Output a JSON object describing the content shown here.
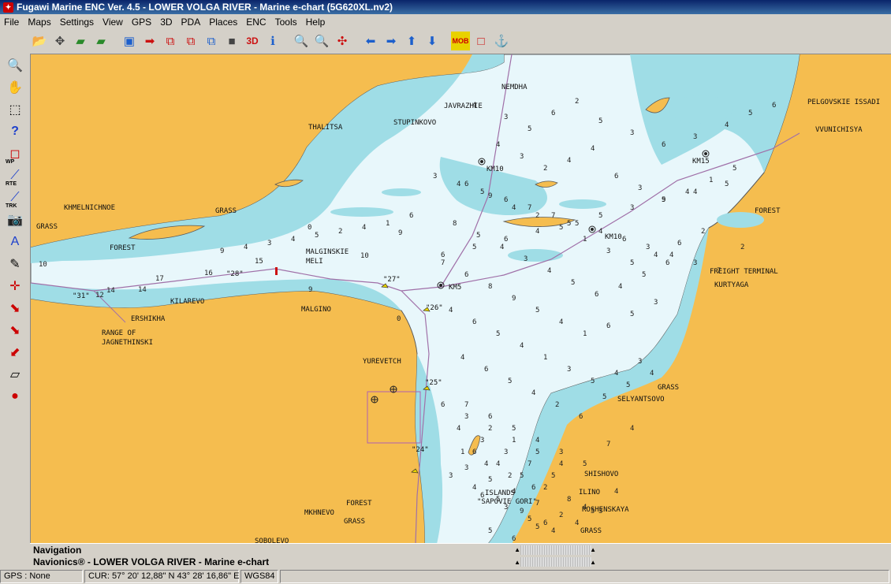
{
  "window": {
    "title": "Fugawi Marine ENC Ver. 4.5 - LOWER VOLGA RIVER - Marine e-chart  (5G620XL.nv2)"
  },
  "menu": [
    "File",
    "Maps",
    "Settings",
    "View",
    "GPS",
    "3D",
    "PDA",
    "Places",
    "ENC",
    "Tools",
    "Help"
  ],
  "toolbar": {
    "buttons": [
      {
        "name": "open-folder-icon",
        "glyph": "📂"
      },
      {
        "name": "move-icon",
        "glyph": "✥"
      },
      {
        "name": "layers-up-icon",
        "glyph": "▰"
      },
      {
        "name": "layers-down-icon",
        "glyph": "▰"
      },
      {
        "name": "screen-icon",
        "glyph": "▣"
      },
      {
        "name": "arrow-right-box-icon",
        "glyph": "➡"
      },
      {
        "name": "window-icon",
        "glyph": "⧉"
      },
      {
        "name": "window-select-icon",
        "glyph": "⧉"
      },
      {
        "name": "window-refresh-icon",
        "glyph": "⧉"
      },
      {
        "name": "gray-square-icon",
        "glyph": "■"
      },
      {
        "name": "three-d-icon",
        "glyph": "3D"
      },
      {
        "name": "info-icon",
        "glyph": "ℹ"
      },
      {
        "name": "zoom-out-icon",
        "glyph": "🔍"
      },
      {
        "name": "zoom-in-icon",
        "glyph": "🔍"
      },
      {
        "name": "fit-arrows-icon",
        "glyph": "✣"
      },
      {
        "name": "pan-left-icon",
        "glyph": "⬅"
      },
      {
        "name": "pan-right-icon",
        "glyph": "➡"
      },
      {
        "name": "pan-up-icon",
        "glyph": "⬆"
      },
      {
        "name": "pan-down-icon",
        "glyph": "⬇"
      },
      {
        "name": "mob-icon",
        "glyph": "MOB"
      },
      {
        "name": "red-square-icon",
        "glyph": "□"
      },
      {
        "name": "anchor-icon",
        "glyph": "⚓"
      }
    ],
    "colors": {
      "blue": "#1c5fcc",
      "red": "#cc1111",
      "green": "#2a8a2a",
      "yellow": "#e8d200"
    }
  },
  "left_tools": [
    {
      "name": "magnifier-icon",
      "glyph": "🔍",
      "label": ""
    },
    {
      "name": "hand-icon",
      "glyph": "✋",
      "label": ""
    },
    {
      "name": "select-rect-icon",
      "glyph": "⬚",
      "label": ""
    },
    {
      "name": "question-icon",
      "glyph": "?",
      "label": ""
    },
    {
      "name": "waypoint-icon",
      "glyph": "◻",
      "label": "WP"
    },
    {
      "name": "route-icon",
      "glyph": "⟋",
      "label": "RTE"
    },
    {
      "name": "track-icon",
      "glyph": "⟋",
      "label": "TRK"
    },
    {
      "name": "camera-icon",
      "glyph": "📷",
      "label": ""
    },
    {
      "name": "text-tool-icon",
      "glyph": "A",
      "label": ""
    },
    {
      "name": "pen-icon",
      "glyph": "✎",
      "label": ""
    },
    {
      "name": "crosshair-icon",
      "glyph": "✛",
      "label": ""
    },
    {
      "name": "route-join-icon",
      "glyph": "⬊",
      "label": ""
    },
    {
      "name": "route-split-icon",
      "glyph": "⬊",
      "label": ""
    },
    {
      "name": "route-erase-icon",
      "glyph": "⬋",
      "label": ""
    },
    {
      "name": "layer-up-icon",
      "glyph": "▱",
      "label": ""
    },
    {
      "name": "record-track-icon",
      "glyph": "●",
      "label": ""
    }
  ],
  "map": {
    "colors": {
      "land": "#f5bd4f",
      "deep": "#e8f7fb",
      "shallow": "#9fdde6",
      "drying": "#c8c87a",
      "route": "#a070a8",
      "text": "#111111"
    },
    "place_labels": [
      {
        "id": "nemdha",
        "text": "NEMDHA"
      },
      {
        "id": "javrazhie",
        "text": "JAVRAZHIE"
      },
      {
        "id": "stupinkovo",
        "text": "STUPINKOVO"
      },
      {
        "id": "thalitsa",
        "text": "THALITSA"
      },
      {
        "id": "pelgovskie",
        "text": "PELGOVSKIE ISSADI"
      },
      {
        "id": "vvunichisya",
        "text": "VVUNICHISYA"
      },
      {
        "id": "khmelnichnoe",
        "text": "KHMELNICHNOE"
      },
      {
        "id": "grass1",
        "text": "GRASS"
      },
      {
        "id": "grass2",
        "text": "GRASS"
      },
      {
        "id": "forest1",
        "text": "FOREST"
      },
      {
        "id": "forest2",
        "text": "FOREST"
      },
      {
        "id": "malginskie",
        "text": "MALGINSKIE"
      },
      {
        "id": "meli",
        "text": "MELI"
      },
      {
        "id": "freight",
        "text": "FREIGHT TERMINAL"
      },
      {
        "id": "kurtyaga",
        "text": "KURTYAGA"
      },
      {
        "id": "kilarevo",
        "text": "KILAREVO"
      },
      {
        "id": "malgino",
        "text": "MALGINO"
      },
      {
        "id": "ershikha",
        "text": "ERSHIKHA"
      },
      {
        "id": "range",
        "text": "RANGE OF"
      },
      {
        "id": "jagnethinski",
        "text": "JAGNETHINSKI"
      },
      {
        "id": "yurevetch",
        "text": "YUREVETCH"
      },
      {
        "id": "grass3",
        "text": "GRASS"
      },
      {
        "id": "selyantsovo",
        "text": "SELYANTSOVO"
      },
      {
        "id": "shishovo",
        "text": "SHISHOVO"
      },
      {
        "id": "islands",
        "text": "ISLANDS"
      },
      {
        "id": "sapovie",
        "text": "\"SAPOVIE GORI\""
      },
      {
        "id": "ilino",
        "text": "ILINO"
      },
      {
        "id": "roshenskaya",
        "text": "ROSHENSKAYA"
      },
      {
        "id": "forest3",
        "text": "FOREST"
      },
      {
        "id": "mkhnevo",
        "text": "MKHNEVO"
      },
      {
        "id": "grass4",
        "text": "GRASS"
      },
      {
        "id": "grass5",
        "text": "GRASS"
      },
      {
        "id": "sobolevo",
        "text": "SOBOLEVO"
      },
      {
        "id": "km5",
        "text": "KM5"
      },
      {
        "id": "km10a",
        "text": "KM10"
      },
      {
        "id": "km10b",
        "text": "KM10"
      },
      {
        "id": "km15",
        "text": "KM15"
      },
      {
        "id": "buoy31",
        "text": "\"31\""
      },
      {
        "id": "buoy28",
        "text": "\"28\""
      },
      {
        "id": "buoy27",
        "text": "\"27\""
      },
      {
        "id": "buoy26",
        "text": "\"26\""
      },
      {
        "id": "buoy25",
        "text": "\"25\""
      },
      {
        "id": "buoy24",
        "text": "\"24\""
      }
    ],
    "soundings": [
      "4",
      "3",
      "5",
      "6",
      "2",
      "5",
      "3",
      "6",
      "3",
      "4",
      "5",
      "6",
      "4",
      "3",
      "2",
      "4",
      "4",
      "6",
      "3",
      "5",
      "4",
      "1",
      "5",
      "6",
      "9",
      "4",
      "2",
      "5",
      "1",
      "3",
      "5",
      "4",
      "6",
      "2",
      "8",
      "5",
      "4",
      "3",
      "4",
      "5",
      "6",
      "4",
      "5",
      "6",
      "7",
      "6",
      "8",
      "9",
      "5",
      "4",
      "1",
      "6",
      "5",
      "3",
      "4",
      "6",
      "5",
      "4",
      "1",
      "3",
      "5",
      "4",
      "3",
      "4",
      "6",
      "5",
      "4",
      "2",
      "6",
      "5",
      "5",
      "4",
      "7",
      "6",
      "5",
      "4",
      "3",
      "5",
      "7",
      "4",
      "6",
      "4",
      "5",
      "2",
      "8",
      "5",
      "4",
      "6",
      "3",
      "5",
      "4",
      "4",
      "3",
      "5",
      "6",
      "5",
      "2",
      "4",
      "6",
      "3",
      "2",
      "1",
      "5",
      "4",
      "3",
      "4",
      "5",
      "9",
      "6",
      "4",
      "3",
      "3",
      "7",
      "5",
      "1",
      "4",
      "2",
      "6",
      "3",
      "5",
      "4",
      "7",
      "6",
      "5",
      "6",
      "4",
      "5",
      "5",
      "3",
      "9",
      "4",
      "5",
      "2",
      "7",
      "3",
      "4",
      "3",
      "6",
      "4",
      "5",
      "7",
      "7",
      "6",
      "5",
      "4",
      "3",
      "6",
      "1",
      "4",
      "2",
      "5",
      "4",
      "3",
      "4",
      "9",
      "1",
      "0",
      "4",
      "6"
    ],
    "sounding_labels": [
      "10",
      "17",
      "16",
      "14",
      "15",
      "14",
      "10",
      "12",
      "0",
      "9",
      "0",
      "9"
    ]
  },
  "panels": {
    "navigation": "Navigation",
    "chart_name": "Navionics® - LOWER VOLGA RIVER - Marine e-chart"
  },
  "status": {
    "gps": "GPS : None",
    "cursor": "CUR: 57° 20' 12,88\" N 43° 28' 16,86\" E",
    "datum": "WGS84"
  }
}
